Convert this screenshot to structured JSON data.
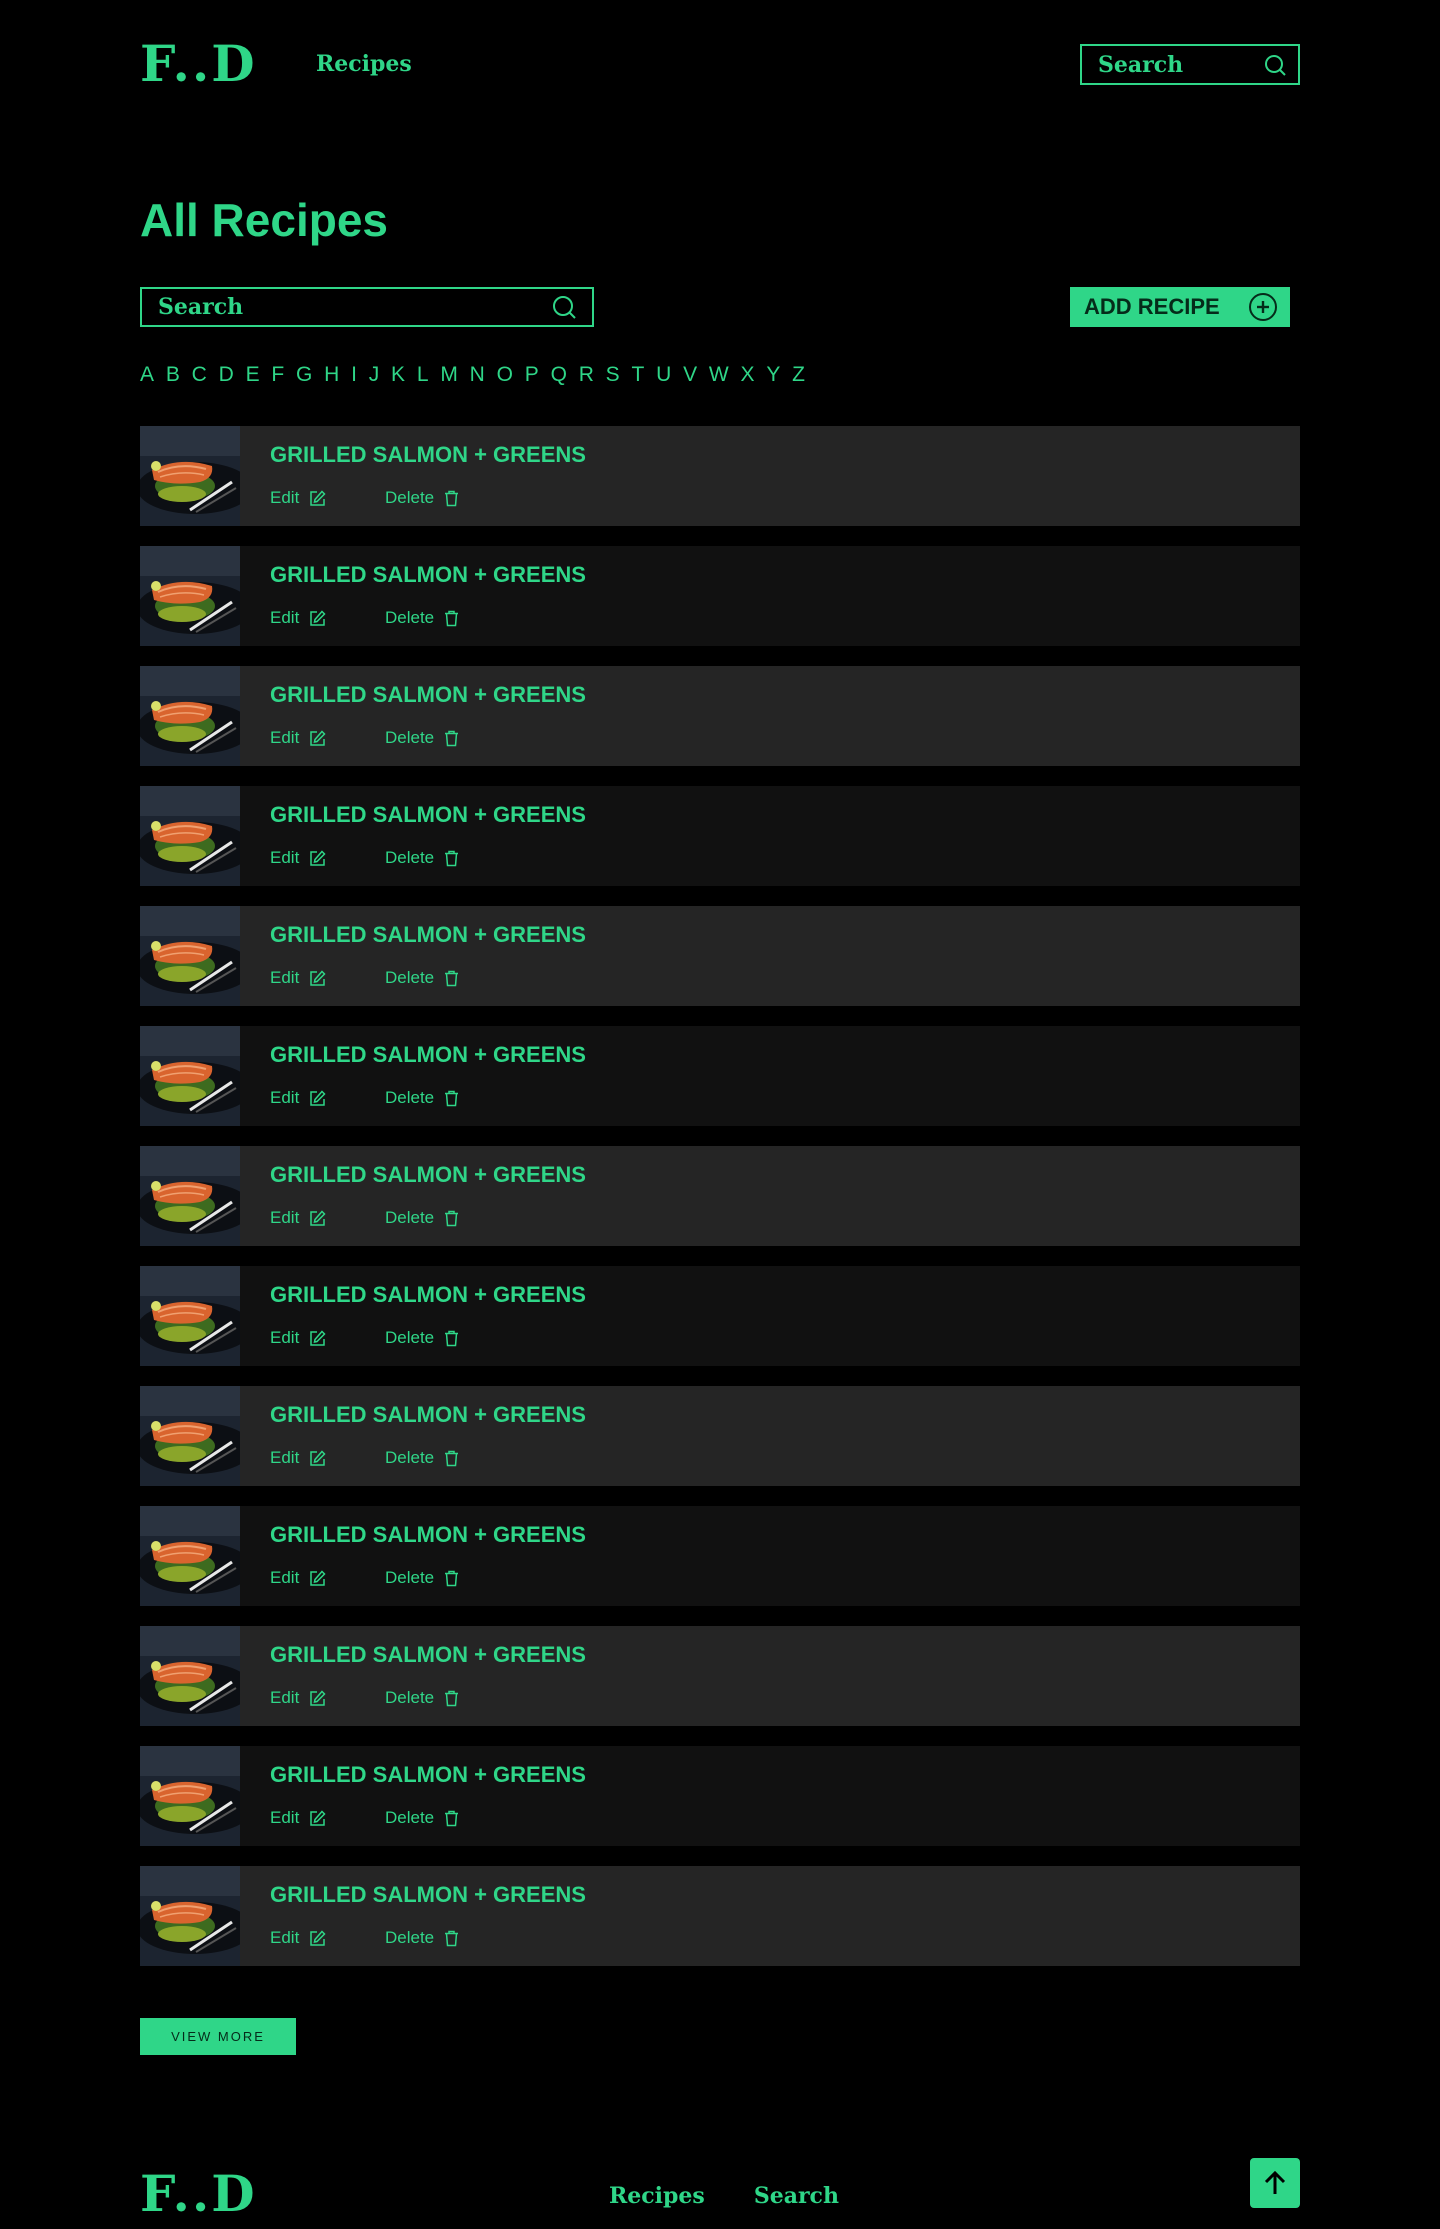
{
  "header": {
    "logo": "F..D",
    "nav_recipes": "Recipes",
    "search_label": "Search"
  },
  "page_title": "All Recipes",
  "toolbar": {
    "search_label": "Search",
    "add_label": "ADD RECIPE"
  },
  "alphabet": [
    "A",
    "B",
    "C",
    "D",
    "E",
    "F",
    "G",
    "H",
    "I",
    "J",
    "K",
    "L",
    "M",
    "N",
    "O",
    "P",
    "Q",
    "R",
    "S",
    "T",
    "U",
    "V",
    "W",
    "X",
    "Y",
    "Z"
  ],
  "recipes": [
    {
      "title": "GRILLED SALMON + GREENS",
      "edit": "Edit",
      "delete": "Delete"
    },
    {
      "title": "GRILLED SALMON + GREENS",
      "edit": "Edit",
      "delete": "Delete"
    },
    {
      "title": "GRILLED SALMON + GREENS",
      "edit": "Edit",
      "delete": "Delete"
    },
    {
      "title": "GRILLED SALMON + GREENS",
      "edit": "Edit",
      "delete": "Delete"
    },
    {
      "title": "GRILLED SALMON + GREENS",
      "edit": "Edit",
      "delete": "Delete"
    },
    {
      "title": "GRILLED SALMON + GREENS",
      "edit": "Edit",
      "delete": "Delete"
    },
    {
      "title": "GRILLED SALMON + GREENS",
      "edit": "Edit",
      "delete": "Delete"
    },
    {
      "title": "GRILLED SALMON + GREENS",
      "edit": "Edit",
      "delete": "Delete"
    },
    {
      "title": "GRILLED SALMON + GREENS",
      "edit": "Edit",
      "delete": "Delete"
    },
    {
      "title": "GRILLED SALMON + GREENS",
      "edit": "Edit",
      "delete": "Delete"
    },
    {
      "title": "GRILLED SALMON + GREENS",
      "edit": "Edit",
      "delete": "Delete"
    },
    {
      "title": "GRILLED SALMON + GREENS",
      "edit": "Edit",
      "delete": "Delete"
    },
    {
      "title": "GRILLED SALMON + GREENS",
      "edit": "Edit",
      "delete": "Delete"
    }
  ],
  "view_more": "VIEW MORE",
  "footer": {
    "logo": "F..D",
    "nav_recipes": "Recipes",
    "nav_search": "Search"
  },
  "icons": {
    "search": "search-icon",
    "add": "plus-circle-icon",
    "edit": "edit-icon",
    "delete": "trash-icon",
    "to_top": "arrow-up-icon"
  },
  "colors": {
    "accent": "#2fd688",
    "background": "#000000",
    "row_light": "#252525",
    "row_dark": "#111111"
  }
}
